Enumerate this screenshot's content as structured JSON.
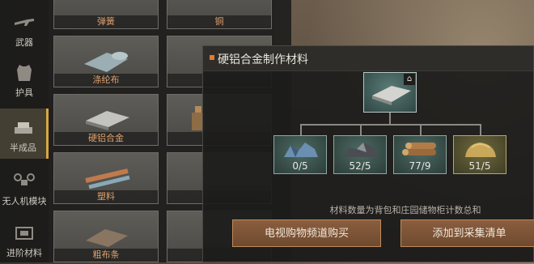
{
  "sidebar": {
    "items": [
      {
        "label": "武器",
        "icon": "rifle-icon"
      },
      {
        "label": "护具",
        "icon": "vest-icon"
      },
      {
        "label": "半成品",
        "icon": "material-pile-icon",
        "active": true
      },
      {
        "label": "无人机模块",
        "icon": "drone-icon"
      },
      {
        "label": "进阶材料",
        "icon": "advanced-material-icon"
      }
    ]
  },
  "grid": {
    "cards": [
      {
        "label": "弹簧",
        "icon": "spring-icon"
      },
      {
        "label": "铜",
        "icon": "copper-icon"
      },
      {
        "label": "涤纶布",
        "icon": "polyester-cloth-icon"
      },
      {
        "label": "",
        "icon": "partial-item-icon"
      },
      {
        "label": "硬铝合金",
        "icon": "duralumin-plate-icon"
      },
      {
        "label": "",
        "icon": "bottle-icon"
      },
      {
        "label": "塑料",
        "icon": "plastic-rods-icon"
      },
      {
        "label": "",
        "icon": "partial-item-icon"
      },
      {
        "label": "粗布条",
        "icon": "cloth-strip-icon"
      },
      {
        "label": "",
        "icon": "partial-item-icon"
      }
    ]
  },
  "panel": {
    "title": "硬铝合金制作材料",
    "root": {
      "icon": "duralumin-plate-icon",
      "badge_icon": "home-icon"
    },
    "materials": [
      {
        "icon": "blue-ore-icon",
        "qty": "0/5"
      },
      {
        "icon": "dark-ore-icon",
        "qty": "52/5"
      },
      {
        "icon": "wood-logs-icon",
        "qty": "77/9"
      },
      {
        "icon": "sand-bag-icon",
        "qty": "51/5"
      }
    ],
    "note": "材料数量为背包和庄园储物柜计数总和",
    "buy_button": "电视购物频道购买",
    "collect_button": "添加到采集清单"
  },
  "colors": {
    "accent": "#d9a741",
    "marker": "#e07b2a",
    "label": "#e0a06e",
    "button": "#7d553a"
  }
}
